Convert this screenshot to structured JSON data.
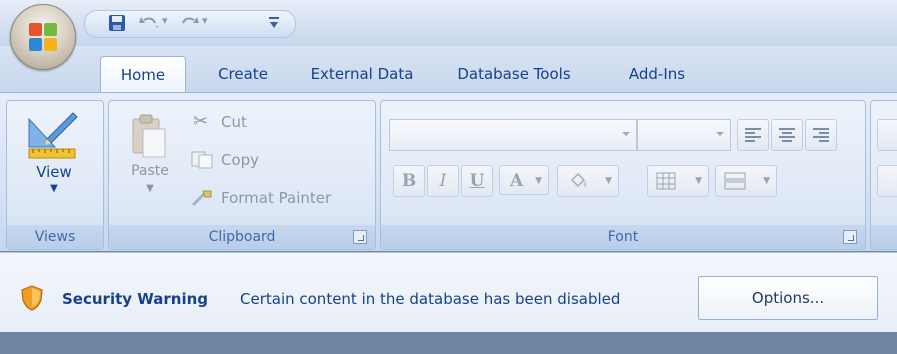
{
  "tabs": [
    {
      "label": "Home",
      "active": true
    },
    {
      "label": "Create",
      "active": false
    },
    {
      "label": "External Data",
      "active": false
    },
    {
      "label": "Database Tools",
      "active": false
    },
    {
      "label": "Add-Ins",
      "active": false
    }
  ],
  "ribbon": {
    "views": {
      "view_label": "View",
      "group_label": "Views"
    },
    "clipboard": {
      "paste_label": "Paste",
      "cut_label": "Cut",
      "copy_label": "Copy",
      "format_painter_label": "Format Painter",
      "group_label": "Clipboard"
    },
    "font": {
      "bold_label": "B",
      "italic_label": "I",
      "underline_label": "U",
      "font_color_label": "A",
      "group_label": "Font"
    }
  },
  "message_bar": {
    "title": "Security Warning",
    "text": "Certain content in the database has been disabled",
    "options_label": "Options..."
  },
  "colors": {
    "accent": "#15428b",
    "ribbon_bg": "#dde7f5",
    "shield": "#f0a020"
  },
  "icons": [
    "office-logo-icon",
    "save-icon",
    "undo-icon",
    "redo-icon",
    "customize-qat-icon",
    "view-icon",
    "paste-icon",
    "cut-icon",
    "copy-icon",
    "format-painter-icon",
    "shield-icon"
  ]
}
